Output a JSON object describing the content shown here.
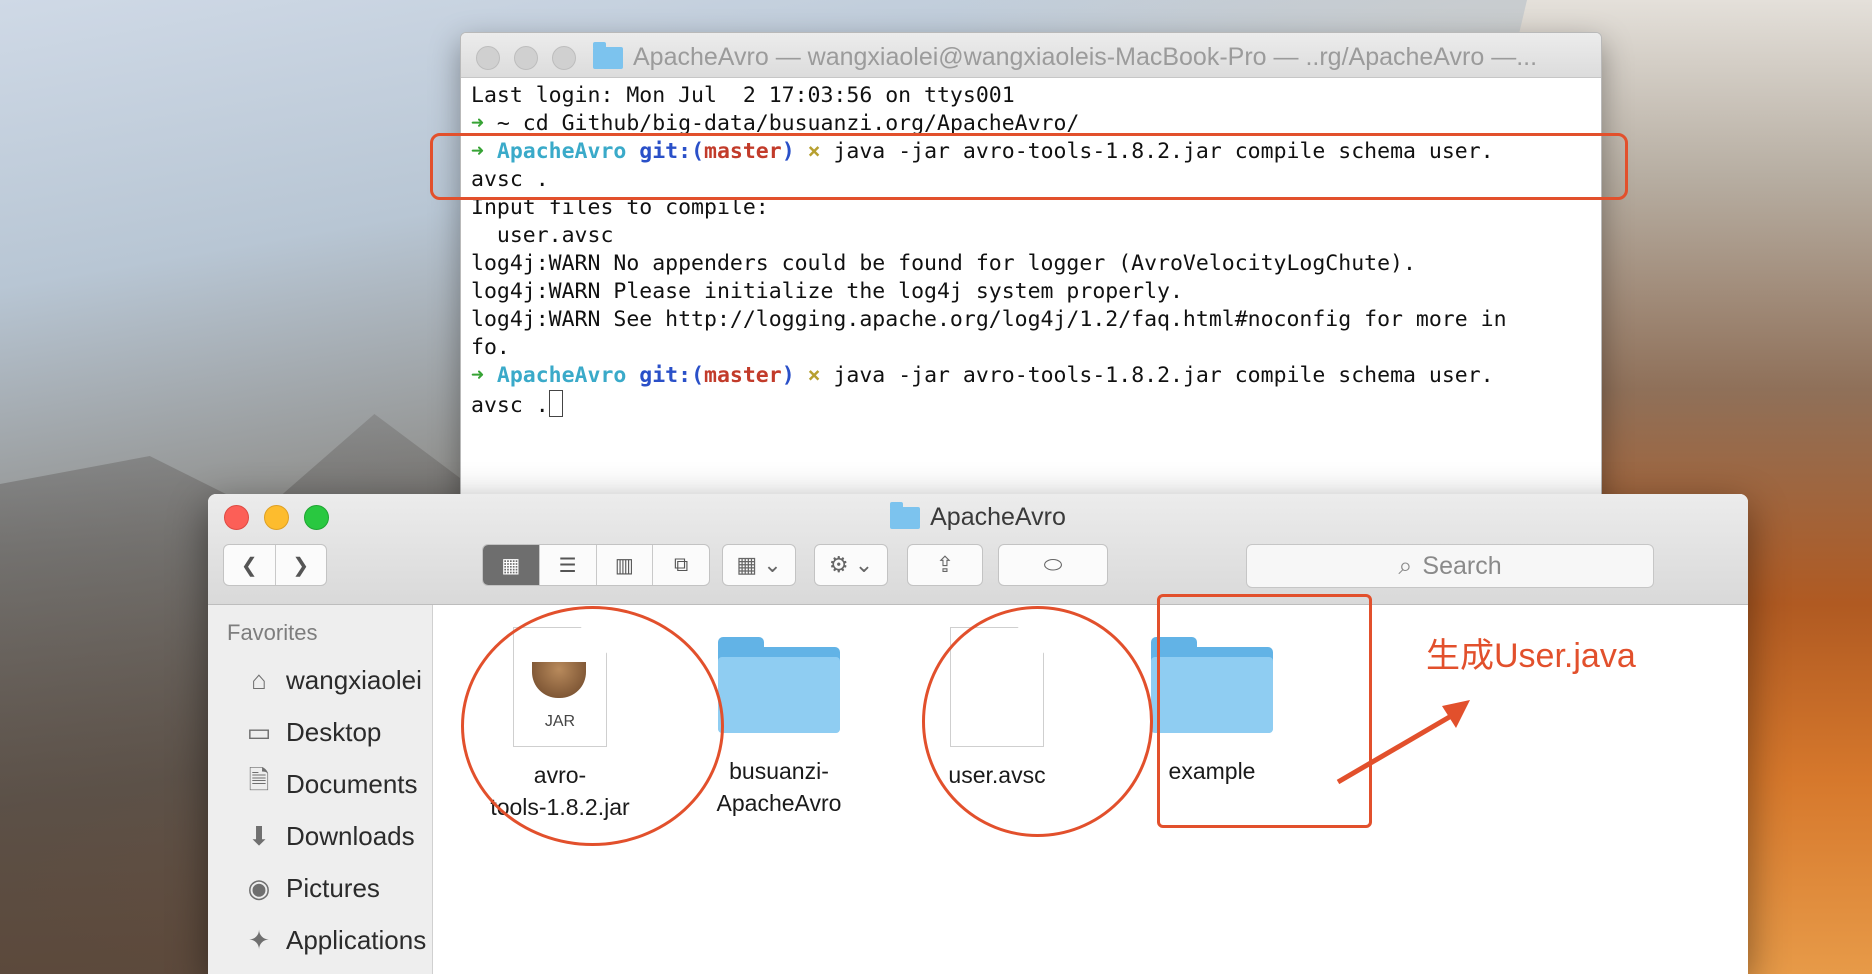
{
  "terminal": {
    "title": "ApacheAvro — wangxiaolei@wangxiaoleis-MacBook-Pro — ..rg/ApacheAvro —...",
    "lines": {
      "l1": "Last login: Mon Jul  2 17:03:56 on ttys001",
      "l2_prompt": "➜",
      "l2_cmd": " ~ cd Github/big-data/busuanzi.org/ApacheAvro/",
      "l3_arrow": "➜",
      "l3_dir": " ApacheAvro",
      "l3_git": " git:(",
      "l3_branch": "master",
      "l3_close": ")",
      "l3_x": " ×",
      "l3_cmd": " java -jar avro-tools-1.8.2.jar compile schema user.",
      "l4": "avsc .",
      "l5": "Input files to compile:",
      "l6": "  user.avsc",
      "l7": "log4j:WARN No appenders could be found for logger (AvroVelocityLogChute).",
      "l8": "log4j:WARN Please initialize the log4j system properly.",
      "l9": "log4j:WARN See http://logging.apache.org/log4j/1.2/faq.html#noconfig for more in",
      "l10": "fo.",
      "l11_arrow": "➜",
      "l11_dir": " ApacheAvro",
      "l11_git": " git:(",
      "l11_branch": "master",
      "l11_close": ")",
      "l11_x": " ×",
      "l11_cmd": " java -jar avro-tools-1.8.2.jar compile schema user.",
      "l12": "avsc ."
    }
  },
  "finder": {
    "title": "ApacheAvro",
    "search_placeholder": "Search",
    "sidebar": {
      "heading": "Favorites",
      "items": [
        {
          "label": "wangxiaolei",
          "icon": "home-icon"
        },
        {
          "label": "Desktop",
          "icon": "desktop-icon"
        },
        {
          "label": "Documents",
          "icon": "documents-icon"
        },
        {
          "label": "Downloads",
          "icon": "downloads-icon"
        },
        {
          "label": "Pictures",
          "icon": "camera-icon"
        },
        {
          "label": "Applications",
          "icon": "applications-icon"
        }
      ]
    },
    "files": [
      {
        "name_line1": "avro-",
        "name_line2": "tools-1.8.2.jar",
        "kind": "jar",
        "badge": "JAR"
      },
      {
        "name_line1": "busuanzi-",
        "name_line2": "ApacheAvro",
        "kind": "folder"
      },
      {
        "name_line1": "user.avsc",
        "name_line2": "",
        "kind": "document"
      },
      {
        "name_line1": "example",
        "name_line2": "",
        "kind": "folder"
      }
    ]
  },
  "annotation": {
    "label": "生成User.java",
    "color": "#e2502c"
  }
}
